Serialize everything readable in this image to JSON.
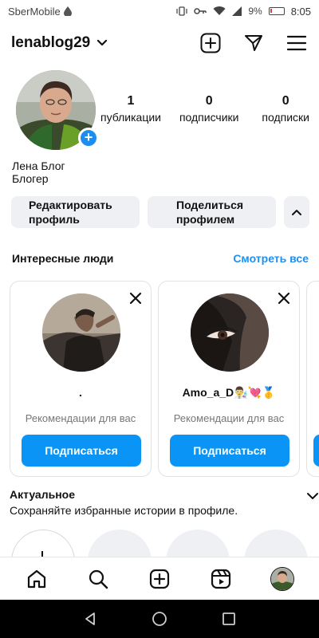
{
  "status_bar": {
    "carrier": "SberMobile",
    "battery": "9%",
    "time": "8:05"
  },
  "header": {
    "username": "lenablog29",
    "icons": [
      "chevron-down-icon",
      "add-post-icon",
      "direct-message-icon",
      "menu-icon"
    ]
  },
  "profile": {
    "stats": [
      {
        "num": "1",
        "label": "публикации"
      },
      {
        "num": "0",
        "label": "подписчики"
      },
      {
        "num": "0",
        "label": "подписки"
      }
    ],
    "name": "Лена Блог",
    "category": "Блогер"
  },
  "actions": {
    "edit_label": "Редактировать\nпрофиль",
    "share_label": "Поделиться\nпрофилем"
  },
  "suggestions": {
    "title": "Интересные люди",
    "see_all": "Смотреть все",
    "cards": [
      {
        "name": ".",
        "reason": "Рекомендации для вас",
        "button": "Подписаться"
      },
      {
        "name": "Amo_a_D👨‍🔬💘🥇",
        "reason": "Рекомендации для вас",
        "button": "Подписаться"
      }
    ]
  },
  "highlights": {
    "title": "Актуальное",
    "subtitle": "Сохраняйте избранные истории в профиле."
  },
  "bottom_nav": [
    "home-icon",
    "search-icon",
    "create-icon",
    "reels-icon",
    "profile-avatar"
  ],
  "colors": {
    "accent": "#0a95f6",
    "link": "#1e90f0",
    "button_bg": "#eef0f3"
  }
}
